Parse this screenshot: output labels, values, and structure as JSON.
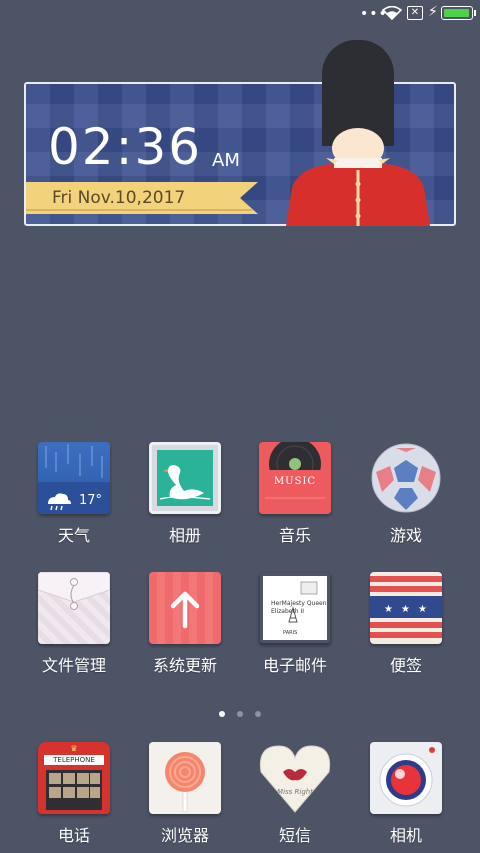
{
  "status_bar": {
    "overflow": "•••",
    "sim": "✕",
    "charging": "⚡",
    "battery_level": 0.95
  },
  "clock": {
    "time": "02:36",
    "ampm": "AM",
    "date": "Fri Nov.10,2017"
  },
  "apps": [
    {
      "label": "天气",
      "icon": "weather-icon",
      "temp": "17°"
    },
    {
      "label": "相册",
      "icon": "swan-gallery-icon"
    },
    {
      "label": "音乐",
      "icon": "vinyl-music-icon",
      "text": "MUSIC"
    },
    {
      "label": "游戏",
      "icon": "soccer-ball-icon"
    },
    {
      "label": "文件管理",
      "icon": "envelope-file-icon"
    },
    {
      "label": "系统更新",
      "icon": "up-arrow-icon"
    },
    {
      "label": "电子邮件",
      "icon": "airmail-letter-icon",
      "text1": "HerMajesty Queen",
      "text2": "Elizabeth II",
      "text3": "PARIS"
    },
    {
      "label": "便签",
      "icon": "stars-stripes-note-icon"
    }
  ],
  "dock": [
    {
      "label": "电话",
      "icon": "telephone-booth-icon",
      "text": "TELEPHONE"
    },
    {
      "label": "浏览器",
      "icon": "lollipop-icon"
    },
    {
      "label": "短信",
      "icon": "lips-envelope-icon",
      "text": "Miss Right"
    },
    {
      "label": "相机",
      "icon": "camera-icon"
    }
  ],
  "pages": {
    "count": 3,
    "active": 0
  },
  "colors": {
    "wallpaper": "#4c5466",
    "widget_blue": "#3b4f8e",
    "battery_green": "#4fd24a"
  }
}
